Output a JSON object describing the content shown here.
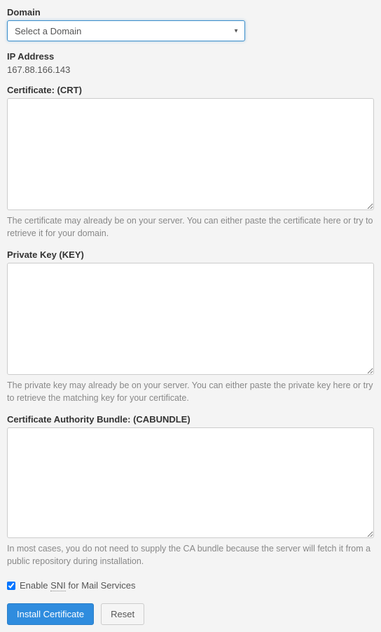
{
  "domain": {
    "label": "Domain",
    "placeholder": "Select a Domain"
  },
  "ip": {
    "label": "IP Address",
    "value": "167.88.166.143"
  },
  "crt": {
    "label": "Certificate: (CRT)",
    "value": "",
    "help": "The certificate may already be on your server. You can either paste the certificate here or try to retrieve it for your domain."
  },
  "key": {
    "label": "Private Key (KEY)",
    "value": "",
    "help": "The private key may already be on your server. You can either paste the private key here or try to retrieve the matching key for your certificate."
  },
  "cabundle": {
    "label": "Certificate Authority Bundle: (CABUNDLE)",
    "value": "",
    "help": "In most cases, you do not need to supply the CA bundle because the server will fetch it from a public repository during installation."
  },
  "sni": {
    "prefix": "Enable",
    "abbr": "SNI",
    "suffix": "for Mail Services",
    "checked": true
  },
  "buttons": {
    "install": "Install Certificate",
    "reset": "Reset"
  }
}
